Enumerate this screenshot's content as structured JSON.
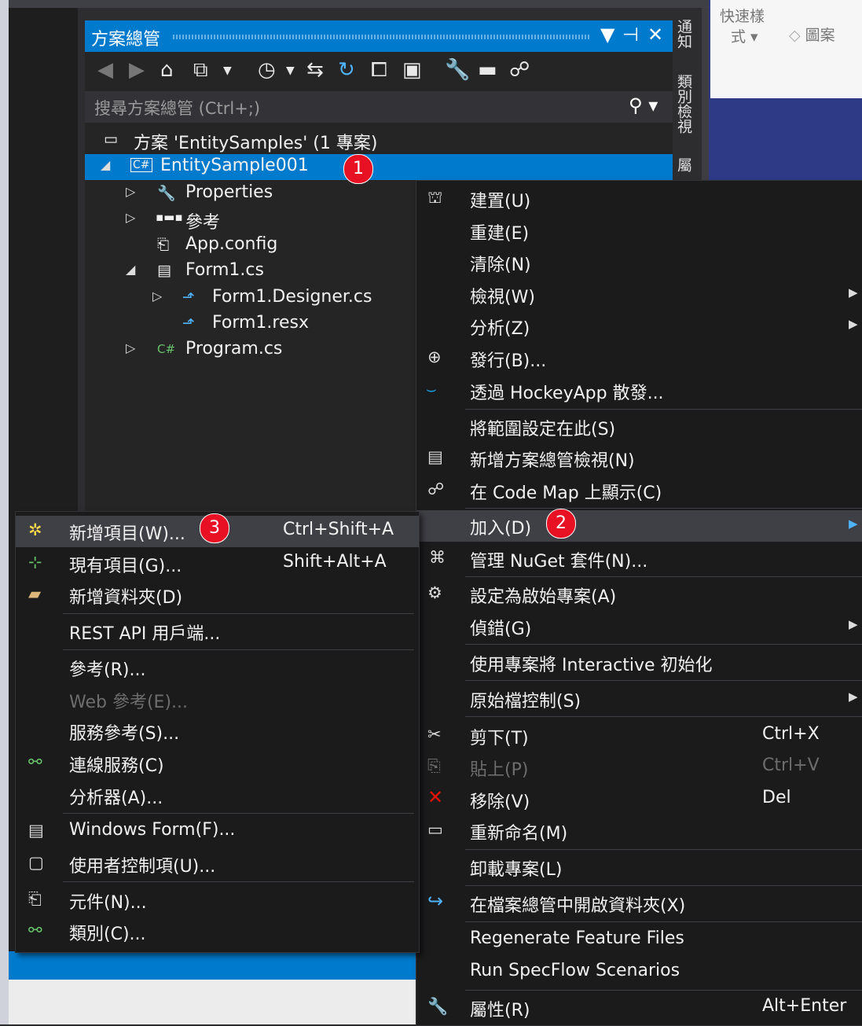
{
  "ribbon": {
    "line1": "快速樣",
    "line2": "式 ▾",
    "line3": "圖案",
    "icon": "eraser-icon"
  },
  "vtabs": [
    "通知",
    "類別檢視",
    "屬"
  ],
  "solution_explorer": {
    "title": "方案總管",
    "controls": [
      "▼",
      "⊣",
      "✕"
    ],
    "toolbar_icons": [
      "back-icon",
      "forward-icon",
      "home-icon",
      "switch-views-icon",
      "dropdown-icon",
      "pending-changes-icon",
      "dropdown-icon",
      "sync-icon",
      "refresh-icon",
      "collapse-all-icon",
      "show-all-files-icon",
      "properties-icon",
      "preview-icon",
      "code-map-icon"
    ],
    "search_placeholder": "搜尋方案總管 (Ctrl+;)",
    "tree": [
      {
        "label": "方案 'EntitySamples' (1 專案)",
        "icon": "solution-icon"
      },
      {
        "label": "EntitySample001",
        "icon": "csharp-project-icon",
        "expanded": true,
        "selected": true
      },
      {
        "label": "Properties",
        "icon": "wrench-icon"
      },
      {
        "label": "參考",
        "icon": "references-icon"
      },
      {
        "label": "App.config",
        "icon": "config-icon"
      },
      {
        "label": "Form1.cs",
        "icon": "form-icon",
        "expanded": true
      },
      {
        "label": "Form1.Designer.cs",
        "icon": "csharp-file-icon"
      },
      {
        "label": "Form1.resx",
        "icon": "resx-icon"
      },
      {
        "label": "Program.cs",
        "icon": "csharp-icon"
      }
    ]
  },
  "badges": [
    "1",
    "2",
    "3"
  ],
  "context_menu": [
    {
      "label": "建置(U)",
      "icon": "build-icon"
    },
    {
      "label": "重建(E)"
    },
    {
      "label": "清除(N)"
    },
    {
      "label": "檢視(W)",
      "submenu": true
    },
    {
      "label": "分析(Z)",
      "submenu": true
    },
    {
      "label": "發行(B)...",
      "icon": "publish-icon"
    },
    {
      "label": "透過 HockeyApp 散發...",
      "icon": "hockeyapp-icon"
    },
    {
      "label": "將範圍設定在此(S)"
    },
    {
      "label": "新增方案總管檢視(N)",
      "icon": "new-view-icon"
    },
    {
      "label": "在 Code Map 上顯示(C)",
      "icon": "code-map-icon"
    },
    {
      "label": "加入(D)",
      "submenu": true,
      "highlighted": true
    },
    {
      "label": "管理 NuGet 套件(N)...",
      "icon": "nuget-icon"
    },
    {
      "label": "設定為啟始專案(A)",
      "icon": "gear-icon"
    },
    {
      "label": "偵錯(G)",
      "submenu": true
    },
    {
      "label": "使用專案將 Interactive 初始化"
    },
    {
      "label": "原始檔控制(S)",
      "submenu": true
    },
    {
      "label": "剪下(T)",
      "shortcut": "Ctrl+X",
      "icon": "scissors-icon"
    },
    {
      "label": "貼上(P)",
      "shortcut": "Ctrl+V",
      "icon": "paste-icon",
      "disabled": true
    },
    {
      "label": "移除(V)",
      "shortcut": "Del",
      "icon": "delete-icon"
    },
    {
      "label": "重新命名(M)",
      "icon": "rename-icon"
    },
    {
      "label": "卸載專案(L)"
    },
    {
      "label": "在檔案總管中開啟資料夾(X)",
      "icon": "open-folder-icon"
    },
    {
      "label": "Regenerate Feature Files"
    },
    {
      "label": "Run SpecFlow Scenarios"
    },
    {
      "label": "屬性(R)",
      "shortcut": "Alt+Enter",
      "icon": "wrench-icon"
    }
  ],
  "add_submenu": [
    {
      "label": "新增項目(W)...",
      "shortcut": "Ctrl+Shift+A",
      "icon": "new-item-icon"
    },
    {
      "label": "現有項目(G)...",
      "shortcut": "Shift+Alt+A",
      "icon": "existing-item-icon"
    },
    {
      "label": "新增資料夾(D)",
      "icon": "new-folder-icon"
    },
    {
      "label": "REST API 用戶端..."
    },
    {
      "label": "參考(R)..."
    },
    {
      "label": "Web 參考(E)...",
      "disabled": true
    },
    {
      "label": "服務參考(S)..."
    },
    {
      "label": "連線服務(C)",
      "icon": "connected-service-icon"
    },
    {
      "label": "分析器(A)..."
    },
    {
      "label": "Windows Form(F)...",
      "icon": "windows-form-icon"
    },
    {
      "label": "使用者控制項(U)...",
      "icon": "user-control-icon"
    },
    {
      "label": "元件(N)...",
      "icon": "component-icon"
    },
    {
      "label": "類別(C)...",
      "icon": "class-icon"
    }
  ]
}
